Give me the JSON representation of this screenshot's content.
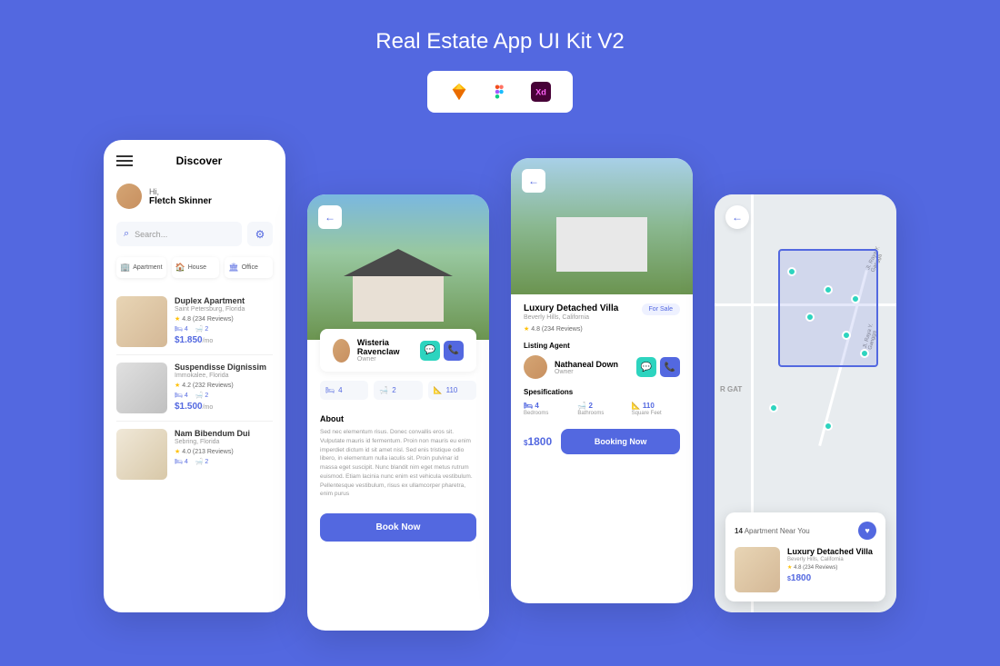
{
  "title": "Real Estate App UI Kit V2",
  "tools": [
    "sketch",
    "figma",
    "xd"
  ],
  "screen1": {
    "header": "Discover",
    "greeting": "Hi,",
    "username": "Fletch Skinner",
    "search_placeholder": "Search...",
    "categories": [
      {
        "icon": "🏢",
        "label": "Apartment"
      },
      {
        "icon": "🏠",
        "label": "House"
      },
      {
        "icon": "🏛",
        "label": "Office"
      }
    ],
    "listings": [
      {
        "title": "Duplex Apartment",
        "location": "Saint Petersburg, Florida",
        "rating": "4.8",
        "reviews": "(234 Reviews)",
        "beds": "4",
        "baths": "2",
        "price": "$1.850",
        "per": "/mo"
      },
      {
        "title": "Suspendisse Dignissim",
        "location": "Immokalee, Florida",
        "rating": "4.2",
        "reviews": "(232 Reviews)",
        "beds": "4",
        "baths": "2",
        "price": "$1.500",
        "per": "/mo"
      },
      {
        "title": "Nam Bibendum Dui",
        "location": "Sebring, Florida",
        "rating": "4.0",
        "reviews": "(213 Reviews)",
        "beds": "4",
        "baths": "2",
        "price": "",
        "per": ""
      }
    ]
  },
  "screen2": {
    "owner_name": "Wisteria Ravenclaw",
    "owner_role": "Owner",
    "specs": [
      {
        "icon": "🛏",
        "value": "4"
      },
      {
        "icon": "🛁",
        "value": "2"
      },
      {
        "icon": "📐",
        "value": "110"
      }
    ],
    "about_heading": "About",
    "about_text": "Sed nec elementum risus. Donec convallis eros sit. Vulputate mauris id fermentum. Proin non mauris eu enim imperdiet dictum id sit amet nisl. Sed enis tristique odio libero, in elementum nulla iaculis sit. Proin pulvinar id massa eget suscipit. Nunc blandit nim eget metus rutrum euismod. Etiam lacinia nunc enim est vehicula vestibulum. Pellentesque vestibulum, risus ex ullamcorper pharetra, enim purus",
    "book_button": "Book Now"
  },
  "screen3": {
    "name": "Luxury Detached Villa",
    "location": "Beverly Hills, California",
    "badge": "For Sale",
    "rating": "4.8",
    "reviews": "(234 Reviews)",
    "agent_heading": "Listing Agent",
    "agent_name": "Nathaneal Down",
    "agent_role": "Owner",
    "specs_heading": "Spesifications",
    "specs": [
      {
        "icon": "🛏",
        "value": "4",
        "label": "Bedrooms"
      },
      {
        "icon": "🛁",
        "value": "2",
        "label": "Bathrooms"
      },
      {
        "icon": "📐",
        "value": "110",
        "label": "Square Feet"
      }
    ],
    "price_currency": "$",
    "price": "1800",
    "book_button": "Booking Now"
  },
  "screen4": {
    "near_count": "14",
    "near_label": "Apartment Near You",
    "streets": [
      "Jl. Raya Y. Gangga",
      "Jl. Raya Y. Gangga"
    ],
    "area_label": "R GAT",
    "listing": {
      "title": "Luxury Detached Villa",
      "location": "Beverly Hills, California",
      "rating": "4.8",
      "reviews": "(234 Reviews)",
      "price_currency": "$",
      "price": "1800"
    }
  }
}
